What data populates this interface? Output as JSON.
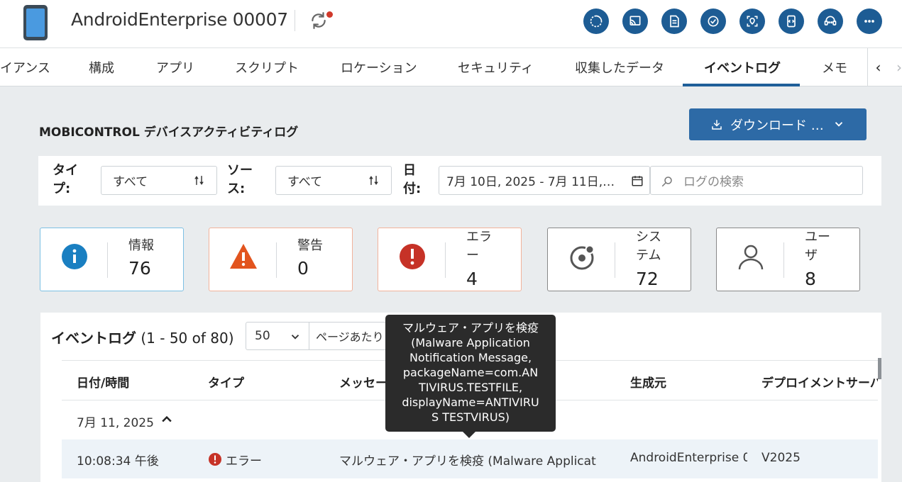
{
  "header": {
    "device_name": "AndroidEnterprise 00007",
    "sync_icon": "sync-icon",
    "actions": [
      {
        "name": "refresh-action-icon"
      },
      {
        "name": "remote-view-icon"
      },
      {
        "name": "document-icon"
      },
      {
        "name": "check-compliance-icon"
      },
      {
        "name": "locate-icon"
      },
      {
        "name": "script-icon"
      },
      {
        "name": "support-chat-icon"
      },
      {
        "name": "more-icon"
      }
    ]
  },
  "tabs": [
    {
      "label": "イアンス",
      "active": false
    },
    {
      "label": "構成",
      "active": false
    },
    {
      "label": "アプリ",
      "active": false
    },
    {
      "label": "スクリプト",
      "active": false
    },
    {
      "label": "ロケーション",
      "active": false
    },
    {
      "label": "セキュリティ",
      "active": false
    },
    {
      "label": "収集したデータ",
      "active": false
    },
    {
      "label": "イベントログ",
      "active": true
    },
    {
      "label": "メモ",
      "active": false
    }
  ],
  "section": {
    "title": "MOBICONTROL デバイスアクティビティログ",
    "download_label": "ダウンロード …"
  },
  "filters": {
    "type_label_1": "タイ",
    "type_label_2": "プ:",
    "type_value": "すべて",
    "source_label_1": "ソー",
    "source_label_2": "ス:",
    "source_value": "すべて",
    "date_label_1": "日",
    "date_label_2": "付:",
    "date_value": "7月 10日, 2025 - 7月 11日,…",
    "search_placeholder": "ログの検索"
  },
  "cards": [
    {
      "name": "info",
      "label": "情報",
      "label2": "",
      "count": "76",
      "icon": "info-icon"
    },
    {
      "name": "warning",
      "label": "警告",
      "label2": "",
      "count": "0",
      "icon": "warning-icon"
    },
    {
      "name": "error",
      "label": "エラ",
      "label2": "ー",
      "count": "4",
      "icon": "error-icon"
    },
    {
      "name": "system",
      "label": "シス",
      "label2": "テム",
      "count": "72",
      "icon": "system-icon"
    },
    {
      "name": "user",
      "label": "ユー",
      "label2": "ザ",
      "count": "8",
      "icon": "user-icon"
    }
  ],
  "table": {
    "title": "イベントログ",
    "range": "(1 - 50 of 80)",
    "page_size": "50",
    "per_page_label": "ページあたり",
    "columns": [
      "日付/時間",
      "タイプ",
      "メッセー",
      "生成元",
      "デプロイメントサーバ"
    ],
    "group_label": "7月 11, 2025",
    "rows": [
      {
        "time": "10:08:34 午後",
        "type": "エラー",
        "message": "マルウェア・アプリを検疫 (Malware Applicat",
        "source": "AndroidEnterprise 0",
        "server": "V2025"
      }
    ]
  },
  "tooltip": {
    "line1": "マルウェア・アプリを検疫",
    "line2": "(Malware Application",
    "line3": "Notification Message,",
    "line4": "packageName=com.AN",
    "line5": "TIVIRUS.TESTFILE,",
    "line6": "displayName=ANTIVIRU",
    "line7": "S TESTVIRUS)"
  },
  "colors": {
    "brand": "#1d5c94",
    "button": "#2d6aa6",
    "info": "#1a7fc1",
    "warning": "#e2541e",
    "error": "#c63227"
  }
}
